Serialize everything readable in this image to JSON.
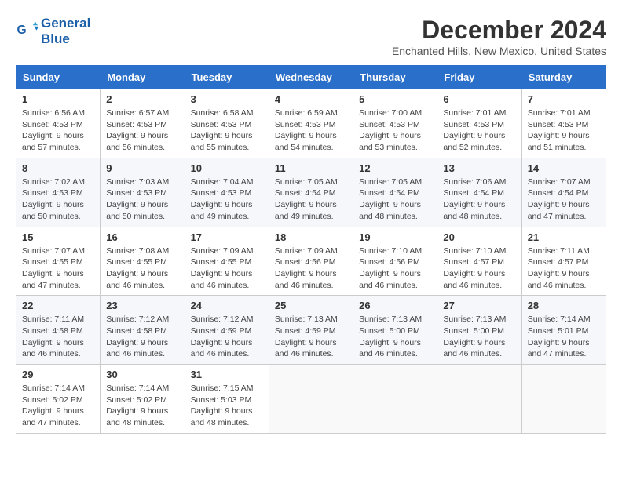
{
  "logo": {
    "line1": "General",
    "line2": "Blue"
  },
  "title": "December 2024",
  "location": "Enchanted Hills, New Mexico, United States",
  "headers": [
    "Sunday",
    "Monday",
    "Tuesday",
    "Wednesday",
    "Thursday",
    "Friday",
    "Saturday"
  ],
  "weeks": [
    [
      {
        "day": "1",
        "detail": "Sunrise: 6:56 AM\nSunset: 4:53 PM\nDaylight: 9 hours\nand 57 minutes."
      },
      {
        "day": "2",
        "detail": "Sunrise: 6:57 AM\nSunset: 4:53 PM\nDaylight: 9 hours\nand 56 minutes."
      },
      {
        "day": "3",
        "detail": "Sunrise: 6:58 AM\nSunset: 4:53 PM\nDaylight: 9 hours\nand 55 minutes."
      },
      {
        "day": "4",
        "detail": "Sunrise: 6:59 AM\nSunset: 4:53 PM\nDaylight: 9 hours\nand 54 minutes."
      },
      {
        "day": "5",
        "detail": "Sunrise: 7:00 AM\nSunset: 4:53 PM\nDaylight: 9 hours\nand 53 minutes."
      },
      {
        "day": "6",
        "detail": "Sunrise: 7:01 AM\nSunset: 4:53 PM\nDaylight: 9 hours\nand 52 minutes."
      },
      {
        "day": "7",
        "detail": "Sunrise: 7:01 AM\nSunset: 4:53 PM\nDaylight: 9 hours\nand 51 minutes."
      }
    ],
    [
      {
        "day": "8",
        "detail": "Sunrise: 7:02 AM\nSunset: 4:53 PM\nDaylight: 9 hours\nand 50 minutes."
      },
      {
        "day": "9",
        "detail": "Sunrise: 7:03 AM\nSunset: 4:53 PM\nDaylight: 9 hours\nand 50 minutes."
      },
      {
        "day": "10",
        "detail": "Sunrise: 7:04 AM\nSunset: 4:53 PM\nDaylight: 9 hours\nand 49 minutes."
      },
      {
        "day": "11",
        "detail": "Sunrise: 7:05 AM\nSunset: 4:54 PM\nDaylight: 9 hours\nand 49 minutes."
      },
      {
        "day": "12",
        "detail": "Sunrise: 7:05 AM\nSunset: 4:54 PM\nDaylight: 9 hours\nand 48 minutes."
      },
      {
        "day": "13",
        "detail": "Sunrise: 7:06 AM\nSunset: 4:54 PM\nDaylight: 9 hours\nand 48 minutes."
      },
      {
        "day": "14",
        "detail": "Sunrise: 7:07 AM\nSunset: 4:54 PM\nDaylight: 9 hours\nand 47 minutes."
      }
    ],
    [
      {
        "day": "15",
        "detail": "Sunrise: 7:07 AM\nSunset: 4:55 PM\nDaylight: 9 hours\nand 47 minutes."
      },
      {
        "day": "16",
        "detail": "Sunrise: 7:08 AM\nSunset: 4:55 PM\nDaylight: 9 hours\nand 46 minutes."
      },
      {
        "day": "17",
        "detail": "Sunrise: 7:09 AM\nSunset: 4:55 PM\nDaylight: 9 hours\nand 46 minutes."
      },
      {
        "day": "18",
        "detail": "Sunrise: 7:09 AM\nSunset: 4:56 PM\nDaylight: 9 hours\nand 46 minutes."
      },
      {
        "day": "19",
        "detail": "Sunrise: 7:10 AM\nSunset: 4:56 PM\nDaylight: 9 hours\nand 46 minutes."
      },
      {
        "day": "20",
        "detail": "Sunrise: 7:10 AM\nSunset: 4:57 PM\nDaylight: 9 hours\nand 46 minutes."
      },
      {
        "day": "21",
        "detail": "Sunrise: 7:11 AM\nSunset: 4:57 PM\nDaylight: 9 hours\nand 46 minutes."
      }
    ],
    [
      {
        "day": "22",
        "detail": "Sunrise: 7:11 AM\nSunset: 4:58 PM\nDaylight: 9 hours\nand 46 minutes."
      },
      {
        "day": "23",
        "detail": "Sunrise: 7:12 AM\nSunset: 4:58 PM\nDaylight: 9 hours\nand 46 minutes."
      },
      {
        "day": "24",
        "detail": "Sunrise: 7:12 AM\nSunset: 4:59 PM\nDaylight: 9 hours\nand 46 minutes."
      },
      {
        "day": "25",
        "detail": "Sunrise: 7:13 AM\nSunset: 4:59 PM\nDaylight: 9 hours\nand 46 minutes."
      },
      {
        "day": "26",
        "detail": "Sunrise: 7:13 AM\nSunset: 5:00 PM\nDaylight: 9 hours\nand 46 minutes."
      },
      {
        "day": "27",
        "detail": "Sunrise: 7:13 AM\nSunset: 5:00 PM\nDaylight: 9 hours\nand 46 minutes."
      },
      {
        "day": "28",
        "detail": "Sunrise: 7:14 AM\nSunset: 5:01 PM\nDaylight: 9 hours\nand 47 minutes."
      }
    ],
    [
      {
        "day": "29",
        "detail": "Sunrise: 7:14 AM\nSunset: 5:02 PM\nDaylight: 9 hours\nand 47 minutes."
      },
      {
        "day": "30",
        "detail": "Sunrise: 7:14 AM\nSunset: 5:02 PM\nDaylight: 9 hours\nand 48 minutes."
      },
      {
        "day": "31",
        "detail": "Sunrise: 7:15 AM\nSunset: 5:03 PM\nDaylight: 9 hours\nand 48 minutes."
      },
      {
        "day": "",
        "detail": ""
      },
      {
        "day": "",
        "detail": ""
      },
      {
        "day": "",
        "detail": ""
      },
      {
        "day": "",
        "detail": ""
      }
    ]
  ]
}
